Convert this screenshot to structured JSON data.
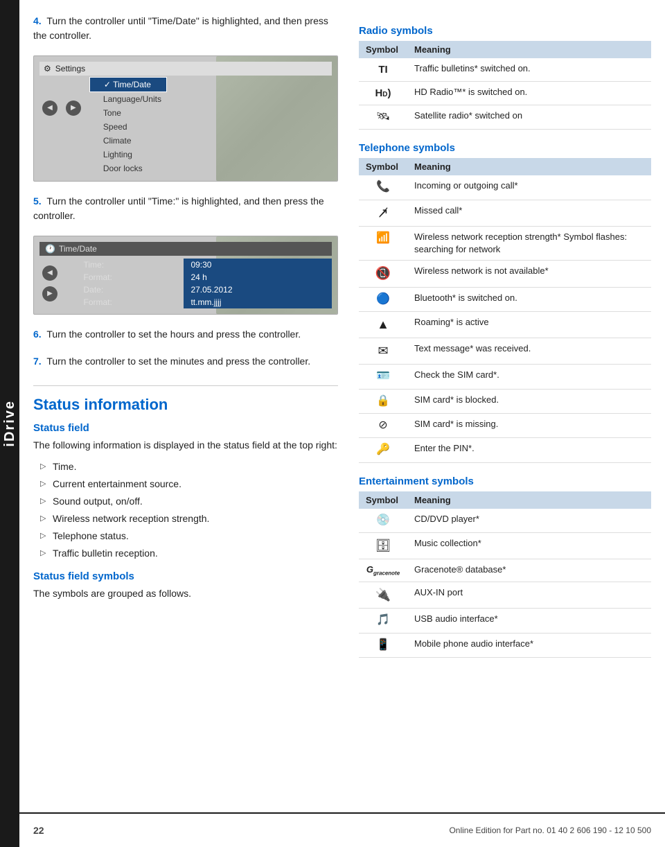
{
  "sidebar": {
    "label": "iDrive"
  },
  "left": {
    "steps": [
      {
        "number": "4.",
        "text": "Turn the controller until \"Time/Date\" is highlighted, and then press the controller."
      },
      {
        "number": "5.",
        "text": "Turn the controller until \"Time:\" is highlighted, and then press the controller."
      },
      {
        "number": "6.",
        "text": "Turn the controller to set the hours and press the controller."
      },
      {
        "number": "7.",
        "text": "Turn the controller to set the minutes and press the controller."
      }
    ],
    "screenshot1": {
      "title": "Settings",
      "menu_items": [
        {
          "label": "Time/Date",
          "highlighted": true
        },
        {
          "label": "Language/Units",
          "highlighted": false
        },
        {
          "label": "Tone",
          "highlighted": false
        },
        {
          "label": "Speed",
          "highlighted": false
        },
        {
          "label": "Climate",
          "highlighted": false
        },
        {
          "label": "Lighting",
          "highlighted": false
        },
        {
          "label": "Door locks",
          "highlighted": false
        }
      ]
    },
    "screenshot2": {
      "title": "Time/Date",
      "rows": [
        {
          "label": "Time:",
          "value": "09:30"
        },
        {
          "label": "Format:",
          "value": "24 h"
        },
        {
          "label": "Date:",
          "value": "27.05.2012"
        },
        {
          "label": "Format:",
          "value": "tt.mm.jjjj"
        }
      ]
    },
    "status_section": {
      "heading": "Status information",
      "status_field_heading": "Status field",
      "status_field_text": "The following information is displayed in the status field at the top right:",
      "status_items": [
        "Time.",
        "Current entertainment source.",
        "Sound output, on/off.",
        "Wireless network reception strength.",
        "Telephone status.",
        "Traffic bulletin reception."
      ],
      "status_symbols_heading": "Status field symbols",
      "status_symbols_text": "The symbols are grouped as follows."
    }
  },
  "right": {
    "radio_section": {
      "heading": "Radio symbols",
      "col_symbol": "Symbol",
      "col_meaning": "Meaning",
      "rows": [
        {
          "symbol": "TI",
          "meaning": "Traffic bulletins* switched on."
        },
        {
          "symbol": "HD)",
          "meaning": "HD Radio™* is switched on."
        },
        {
          "symbol": "🛰",
          "meaning": "Satellite radio* switched on"
        }
      ]
    },
    "telephone_section": {
      "heading": "Telephone symbols",
      "col_symbol": "Symbol",
      "col_meaning": "Meaning",
      "rows": [
        {
          "symbol": "📞",
          "meaning": "Incoming or outgoing call*"
        },
        {
          "symbol": "↗",
          "meaning": "Missed call*"
        },
        {
          "symbol": "📶",
          "meaning": "Wireless network reception strength* Symbol flashes: searching for network"
        },
        {
          "symbol": "📵",
          "meaning": "Wireless network is not available*"
        },
        {
          "symbol": "🔵",
          "meaning": "Bluetooth* is switched on."
        },
        {
          "symbol": "▲",
          "meaning": "Roaming* is active"
        },
        {
          "symbol": "✉",
          "meaning": "Text message* was received."
        },
        {
          "symbol": "💳",
          "meaning": "Check the SIM card*."
        },
        {
          "symbol": "🔒",
          "meaning": "SIM card* is blocked."
        },
        {
          "symbol": "⊘",
          "meaning": "SIM card* is missing."
        },
        {
          "symbol": "🔑",
          "meaning": "Enter the PIN*."
        }
      ]
    },
    "entertainment_section": {
      "heading": "Entertainment symbols",
      "col_symbol": "Symbol",
      "col_meaning": "Meaning",
      "rows": [
        {
          "symbol": "💿",
          "meaning": "CD/DVD player*"
        },
        {
          "symbol": "🗄",
          "meaning": "Music collection*"
        },
        {
          "symbol": "G",
          "meaning": "Gracenote® database*"
        },
        {
          "symbol": "🔌",
          "meaning": "AUX-IN port"
        },
        {
          "symbol": "🎵",
          "meaning": "USB audio interface*"
        },
        {
          "symbol": "📱",
          "meaning": "Mobile phone audio interface*"
        }
      ]
    }
  },
  "footer": {
    "page_number": "22",
    "text": "Online Edition for Part no. 01 40 2 606 190 - 12 10 500"
  }
}
